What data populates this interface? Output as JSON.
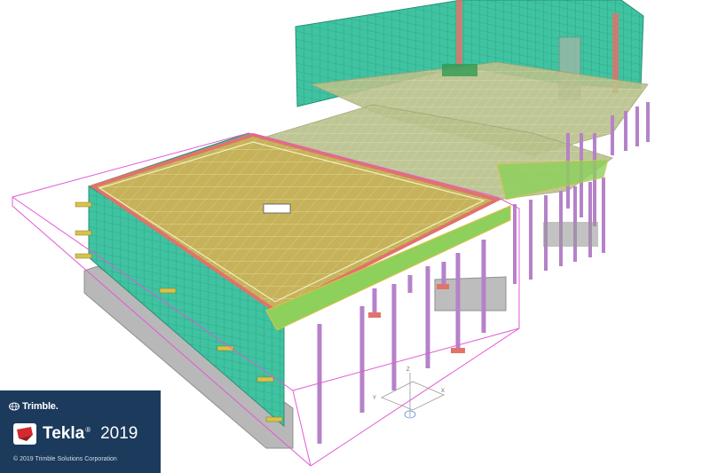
{
  "splash": {
    "brand": "Trimble.",
    "product": "Tekla",
    "registered": "®",
    "version": "2019",
    "copyright": "© 2019 Trimble Solutions Corporation"
  },
  "model_view": {
    "content": "3d-building-formwork-model",
    "axis_labels": {
      "x": "X",
      "y": "Y",
      "z": "Z"
    }
  },
  "colors": {
    "panel_bg": "#1b3a5c",
    "wall_formwork": "#3fc3a0",
    "slab": "#c2b15c",
    "beam_edge": "#e0736b",
    "prop": "#b582c9",
    "bounding_box": "#e05ad7",
    "footing": "#b8b8b8",
    "walers": "#d8c24a",
    "tekla_red": "#d42a2f"
  }
}
